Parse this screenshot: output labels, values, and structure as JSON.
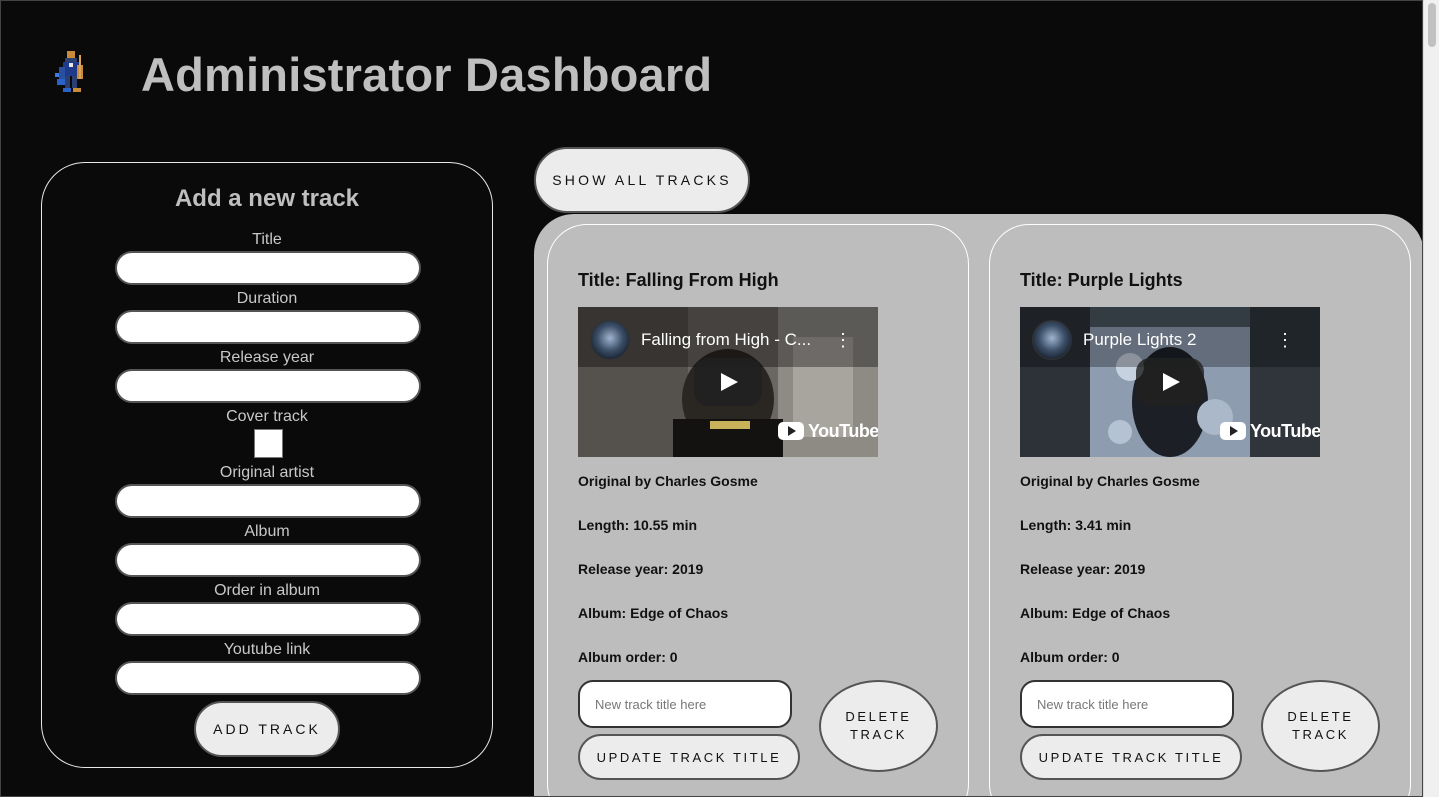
{
  "header": {
    "title": "Administrator Dashboard",
    "logo_icon": "musician-pixel-logo"
  },
  "form": {
    "heading": "Add a new track",
    "fields": [
      {
        "label": "Title",
        "value": "",
        "type": "text"
      },
      {
        "label": "Duration",
        "value": "",
        "type": "text"
      },
      {
        "label": "Release year",
        "value": "",
        "type": "text"
      },
      {
        "label": "Cover track",
        "checked": false,
        "type": "checkbox"
      },
      {
        "label": "Original artist",
        "value": "",
        "type": "text"
      },
      {
        "label": "Album",
        "value": "",
        "type": "text"
      },
      {
        "label": "Order in album",
        "value": "",
        "type": "text"
      },
      {
        "label": "Youtube link",
        "value": "",
        "type": "text"
      }
    ],
    "submit_label": "ADD TRACK"
  },
  "tracks": {
    "show_all_label": "SHOW ALL TRACKS",
    "items": [
      {
        "title": "Title: Falling From High",
        "video_title": "Falling from High - C...",
        "video_brand": "YouTube",
        "original": "Original by Charles Gosme",
        "length": "Length: 10.55 min",
        "release_year": "Release year: 2019",
        "album": "Album: Edge of Chaos",
        "album_order": "Album order: 0",
        "new_title_placeholder": "New track title here",
        "update_label": "UPDATE TRACK TITLE",
        "delete_label": "DELETE TRACK"
      },
      {
        "title": "Title: Purple Lights",
        "video_title": "Purple Lights 2",
        "video_brand": "YouTube",
        "original": "Original by Charles Gosme",
        "length": "Length: 3.41 min",
        "release_year": "Release year: 2019",
        "album": "Album: Edge of Chaos",
        "album_order": "Album order: 0",
        "new_title_placeholder": "New track title here",
        "update_label": "UPDATE TRACK TITLE",
        "delete_label": "DELETE TRACK"
      }
    ]
  },
  "colors": {
    "background": "#0a0a0a",
    "panel": "#bdbdbd",
    "button": "#ececec",
    "heading_text": "#bfbfbf"
  }
}
